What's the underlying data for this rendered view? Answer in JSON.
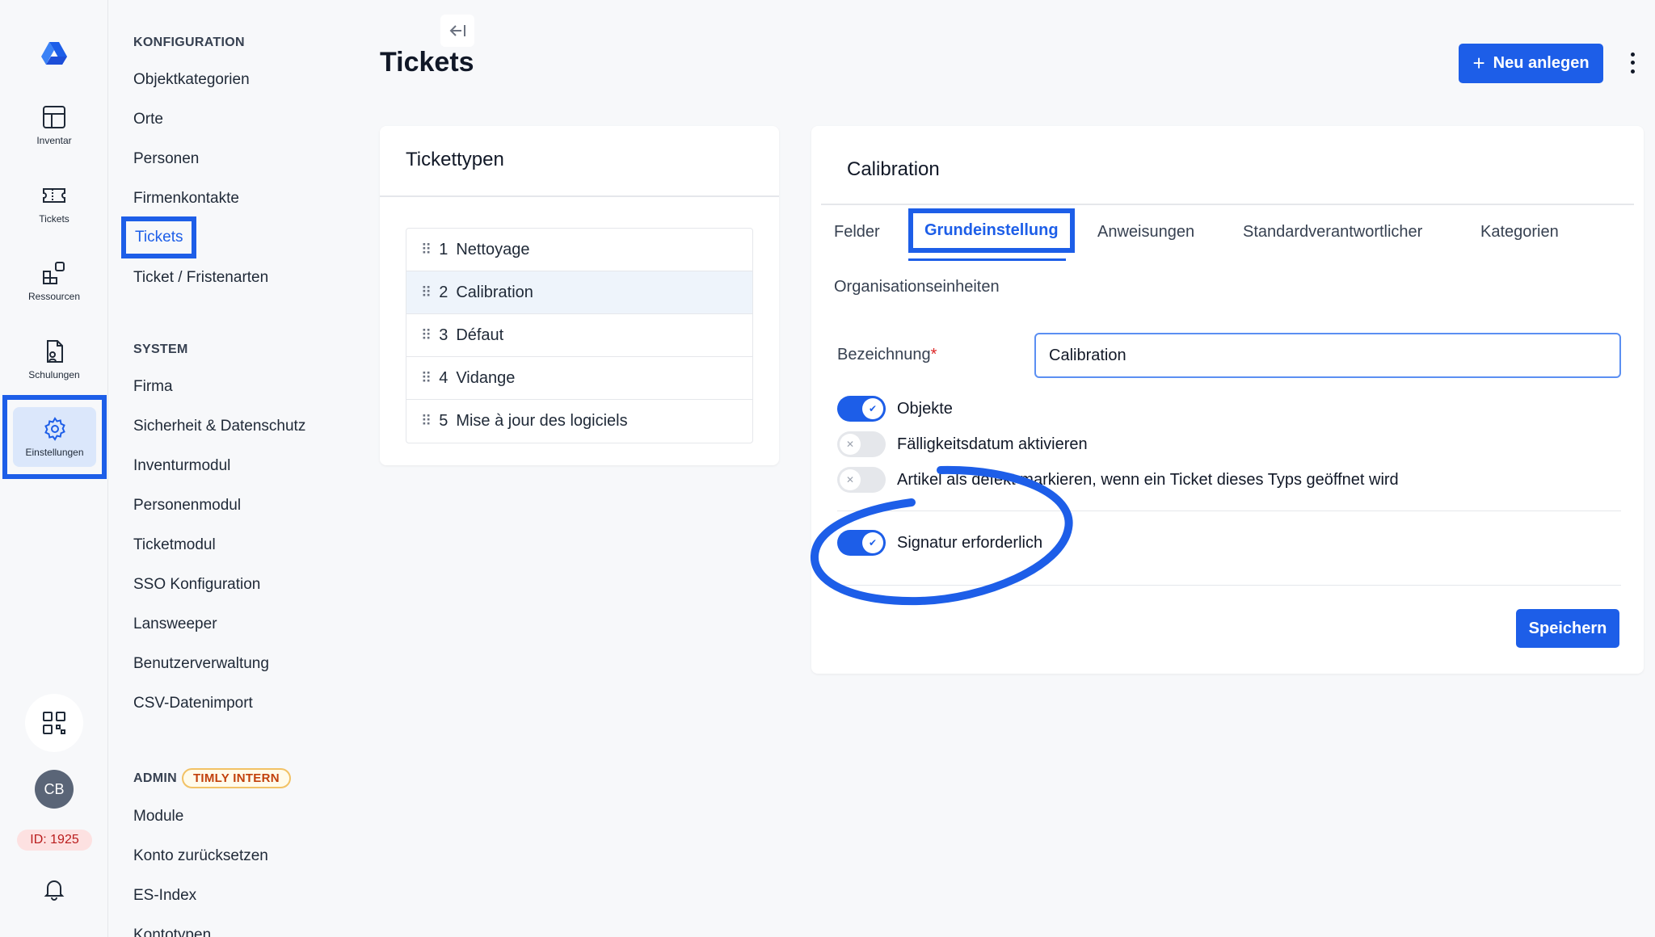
{
  "rail": {
    "items": [
      {
        "label": "Inventar",
        "icon": "inventory-icon"
      },
      {
        "label": "Tickets",
        "icon": "ticket-icon"
      },
      {
        "label": "Ressourcen",
        "icon": "resources-icon"
      },
      {
        "label": "Schulungen",
        "icon": "training-icon"
      },
      {
        "label": "Einstellungen",
        "icon": "gear-icon"
      }
    ],
    "avatar": "CB",
    "id_badge": "ID: 1925"
  },
  "sidebar": {
    "sections": [
      {
        "heading": "KONFIGURATION",
        "items": [
          "Objektkategorien",
          "Orte",
          "Personen",
          "Firmenkontakte",
          "Tickets",
          "Ticket / Fristenarten"
        ]
      },
      {
        "heading": "SYSTEM",
        "items": [
          "Firma",
          "Sicherheit & Datenschutz",
          "Inventurmodul",
          "Personenmodul",
          "Ticketmodul",
          "SSO Konfiguration",
          "Lansweeper",
          "Benutzerverwaltung",
          "CSV-Datenimport"
        ]
      },
      {
        "heading": "ADMIN",
        "badge": "TIMLY INTERN",
        "items": [
          "Module",
          "Konto zurücksetzen",
          "ES-Index",
          "Kontotypen"
        ]
      }
    ],
    "active": "Tickets"
  },
  "header": {
    "title": "Tickets",
    "new_button": "Neu anlegen"
  },
  "types": {
    "title": "Tickettypen",
    "items": [
      {
        "num": "1",
        "name": "Nettoyage"
      },
      {
        "num": "2",
        "name": "Calibration"
      },
      {
        "num": "3",
        "name": "Défaut"
      },
      {
        "num": "4",
        "name": "Vidange"
      },
      {
        "num": "5",
        "name": "Mise à jour des logiciels"
      }
    ],
    "selected_index": 1
  },
  "detail": {
    "title": "Calibration",
    "tabs": [
      "Felder",
      "Grundeinstellung",
      "Anweisungen",
      "Standardverantwortlicher",
      "Kategorien",
      "Organisationseinheiten"
    ],
    "active_tab": "Grundeinstellung",
    "field_label": "Bezeichnung",
    "field_required": "*",
    "field_value": "Calibration",
    "toggles": [
      {
        "label": "Objekte",
        "on": true
      },
      {
        "label": "Fälligkeitsdatum aktivieren",
        "on": false
      },
      {
        "label": "Artikel als defekt markieren, wenn ein Ticket dieses Typs geöffnet wird",
        "on": false
      },
      {
        "label": "Signatur erforderlich",
        "on": true
      }
    ],
    "save_button": "Speichern"
  },
  "colors": {
    "accent": "#1d5ee8",
    "badge_text": "#c2410c",
    "required": "#dc2626"
  }
}
